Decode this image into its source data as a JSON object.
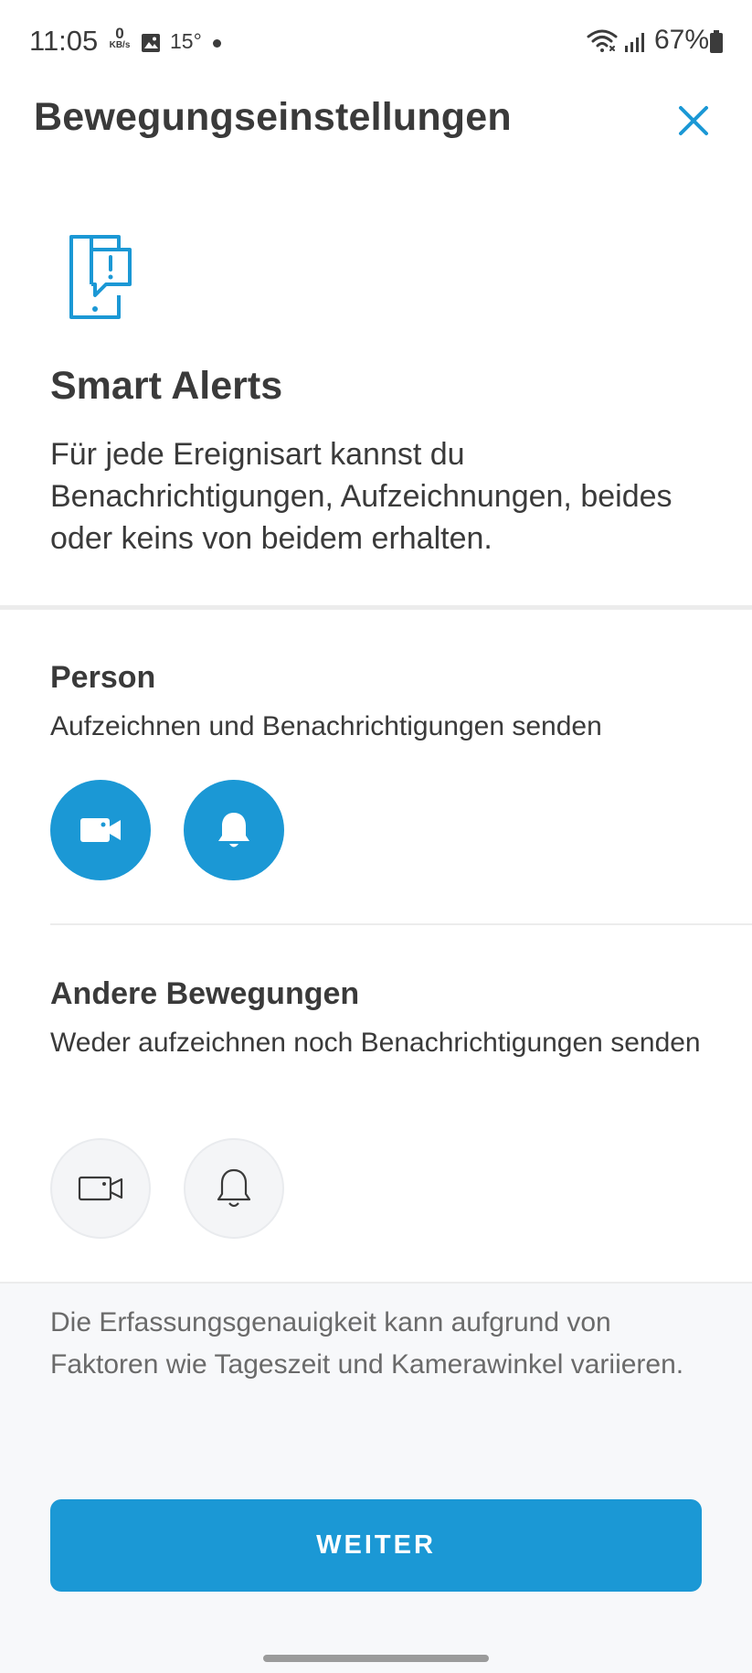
{
  "status_bar": {
    "time": "11:05",
    "net_speed_value": "0",
    "net_speed_unit": "KB/s",
    "temperature": "15°",
    "battery": "67%",
    "icons": [
      "image-icon",
      "wifi-icon",
      "signal-icon",
      "battery-icon"
    ]
  },
  "header": {
    "title": "Bewegungseinstellungen",
    "close_icon": "close-icon"
  },
  "intro": {
    "icon": "phone-alert-icon",
    "title": "Smart Alerts",
    "description": "Für jede Ereignisart kannst du Benachrichtigungen, Aufzeichnungen, beides oder keins von beidem erhalten."
  },
  "sections": [
    {
      "title": "Person",
      "subtitle": "Aufzeichnen und Benachrichtigungen senden",
      "record_enabled": true,
      "notify_enabled": true
    },
    {
      "title": "Andere Bewegungen",
      "subtitle": "Weder aufzeichnen noch Benachrichtigungen senden",
      "record_enabled": false,
      "notify_enabled": false
    }
  ],
  "footer": {
    "note": "Die Erfassungsgenauigkeit kann aufgrund von Faktoren wie Tageszeit und Kamerawinkel variieren.",
    "button_label": "WEITER"
  },
  "colors": {
    "accent": "#1b98d5",
    "text": "#3a3a3a",
    "muted_text": "#6a6a6a",
    "footer_bg": "#f7f8fa"
  }
}
